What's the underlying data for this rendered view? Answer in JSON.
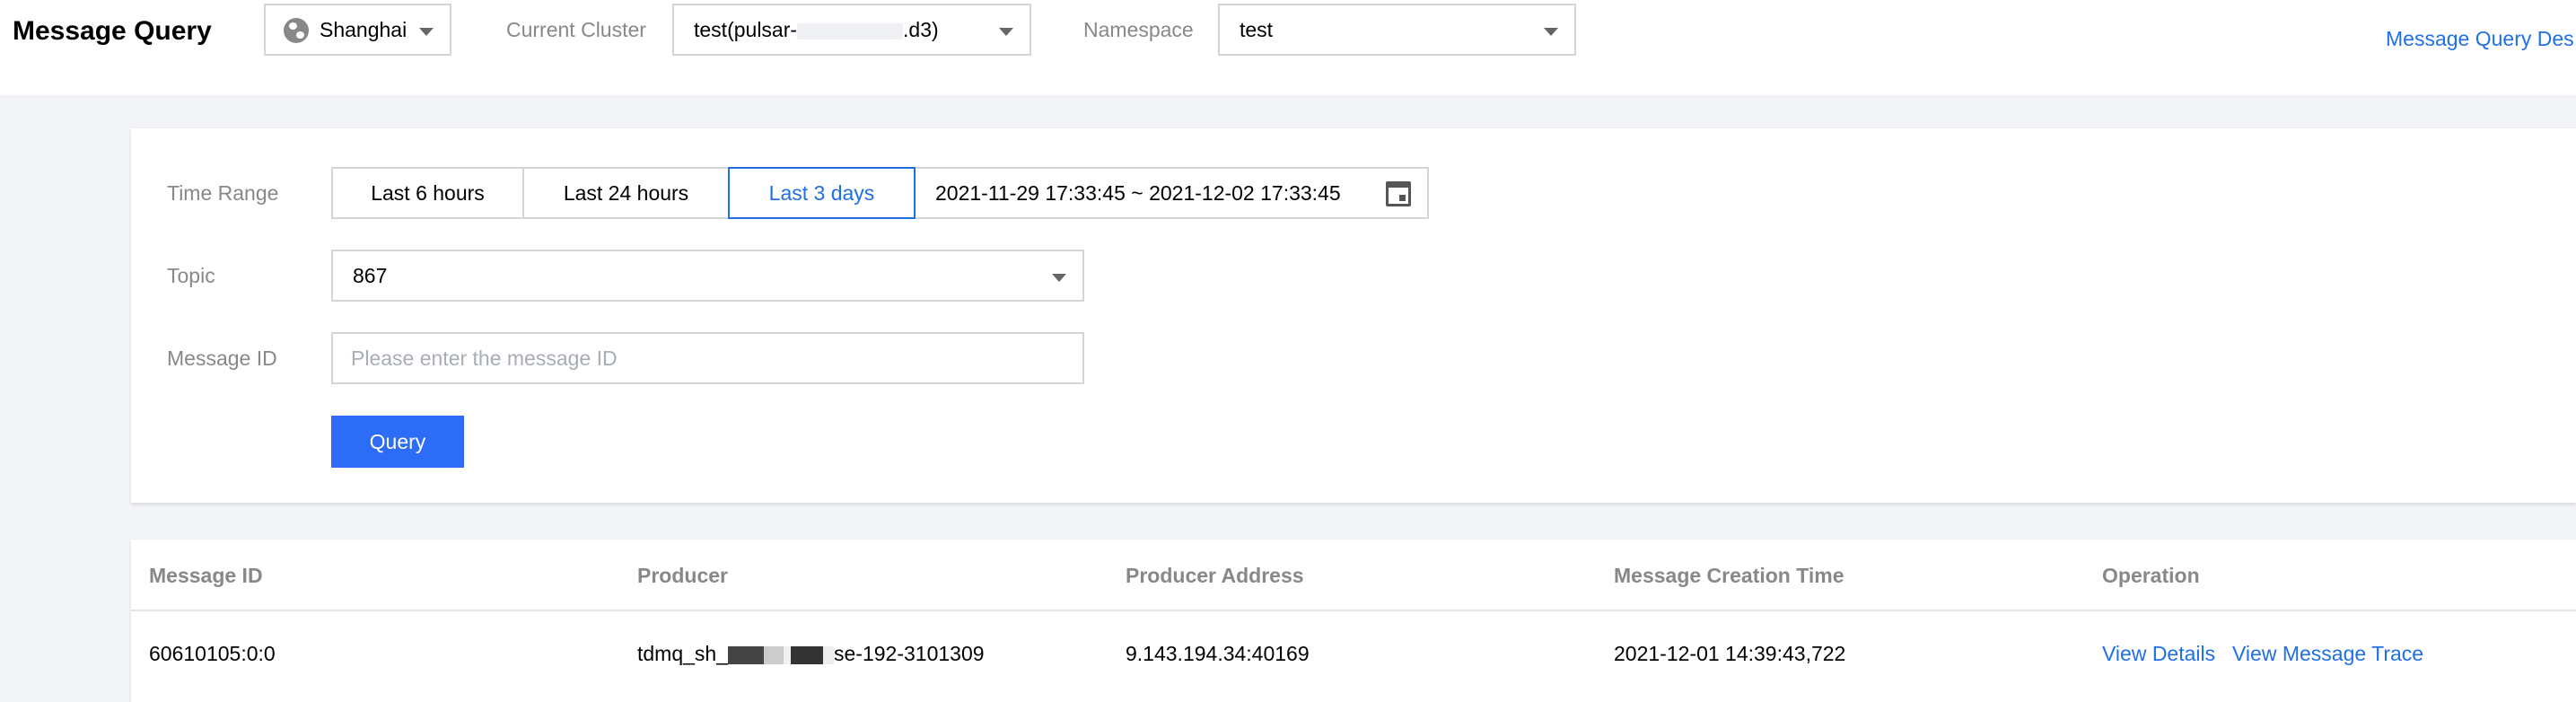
{
  "header": {
    "title": "Message Query",
    "region": {
      "value": "Shanghai",
      "icon": "globe-icon"
    },
    "cluster": {
      "label": "Current Cluster",
      "value_prefix": "test(pulsar-",
      "value_suffix": ".d3)"
    },
    "namespace": {
      "label": "Namespace",
      "value": "test"
    },
    "doc_link": "Message Query Des"
  },
  "filters": {
    "time_range": {
      "label": "Time Range",
      "options": [
        "Last 6 hours",
        "Last 24 hours",
        "Last 3 days"
      ],
      "active": "Last 3 days",
      "range": "2021-11-29 17:33:45 ~ 2021-12-02 17:33:45",
      "icon": "calendar-icon"
    },
    "topic": {
      "label": "Topic",
      "value": "867"
    },
    "message_id": {
      "label": "Message ID",
      "placeholder": "Please enter the message ID"
    },
    "query_label": "Query"
  },
  "table": {
    "columns": [
      "Message ID",
      "Producer",
      "Producer Address",
      "Message Creation Time",
      "Operation"
    ],
    "rows": [
      {
        "message_id": "60610105:0:0",
        "producer_prefix": "tdmq_sh_",
        "producer_suffix": "se-192-3101309",
        "producer_address": "9.143.194.34:40169",
        "creation_time": "2021-12-01 14:39:43,722",
        "actions": [
          "View Details",
          "View Message Trace"
        ]
      }
    ]
  },
  "colors": {
    "accent": "#1f6fe5",
    "primary_button": "#2c6cf6",
    "page_background": "#f3f4f7"
  }
}
